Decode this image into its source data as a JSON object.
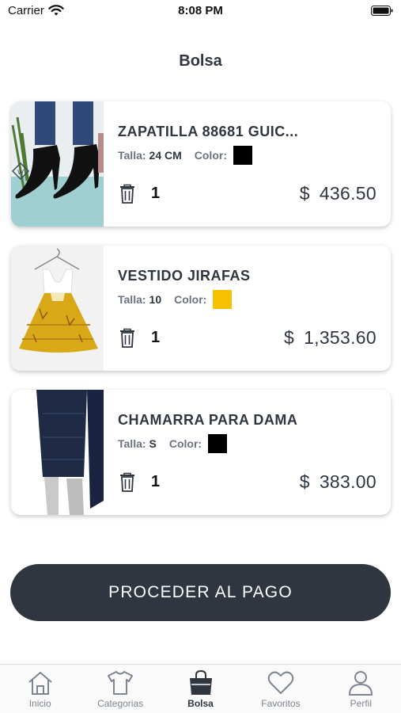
{
  "status": {
    "carrier": "Carrier",
    "time": "8:08 PM"
  },
  "page": {
    "title": "Bolsa"
  },
  "labels": {
    "size": "Talla:",
    "color": "Color:",
    "currency": "$"
  },
  "cart": [
    {
      "name": "ZAPATILLA 88681 GUIC...",
      "size": "24 CM",
      "color_hex": "#000000",
      "qty": "1",
      "price": "436.50",
      "thumb": "black-heels-photo"
    },
    {
      "name": "VESTIDO JIRAFAS",
      "size": "10",
      "color_hex": "#f7c000",
      "qty": "1",
      "price": "1,353.60",
      "thumb": "yellow-dress-photo"
    },
    {
      "name": "CHAMARRA PARA DAMA",
      "size": "S",
      "color_hex": "#000000",
      "qty": "1",
      "price": "383.00",
      "thumb": "navy-jacket-photo"
    }
  ],
  "checkout": {
    "label": "PROCEDER AL PAGO"
  },
  "tabs": [
    {
      "label": "Inicio",
      "icon": "home-icon",
      "active": false
    },
    {
      "label": "Categorias",
      "icon": "tshirt-icon",
      "active": false
    },
    {
      "label": "Bolsa",
      "icon": "shopping-bag-icon",
      "active": true
    },
    {
      "label": "Favoritos",
      "icon": "heart-icon",
      "active": false
    },
    {
      "label": "Perfil",
      "icon": "user-icon",
      "active": false
    }
  ],
  "colors": {
    "primary": "#2f3640",
    "inactive_tab": "#7d8690"
  }
}
